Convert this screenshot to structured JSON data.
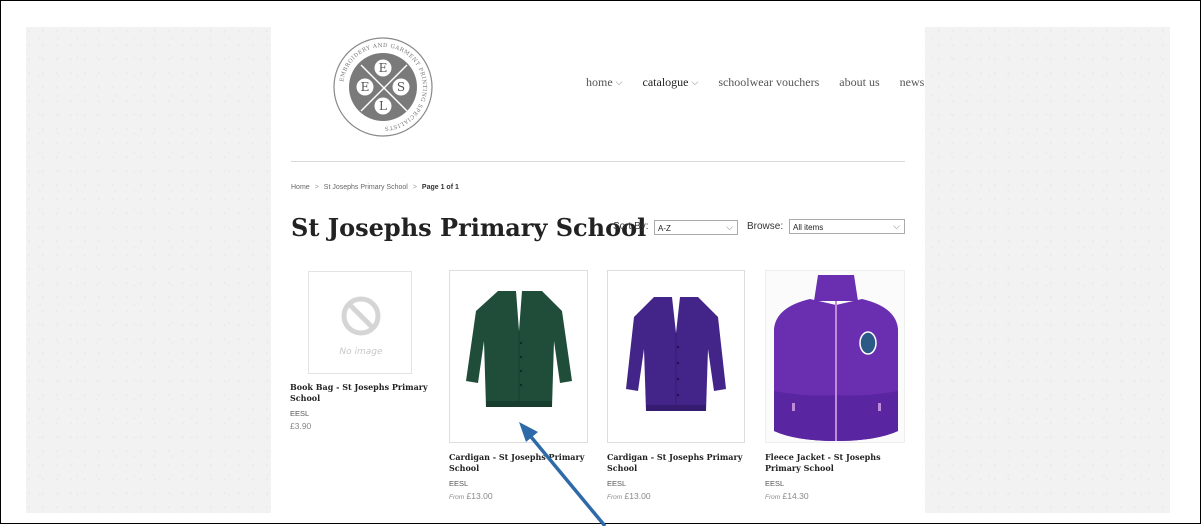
{
  "logo": {
    "ring_text": "EMBROIDERY AND GARMENT PRINTING SPECIALISTS",
    "letters": [
      "E",
      "E",
      "S",
      "L"
    ]
  },
  "nav": {
    "items": [
      {
        "label": "home",
        "has_caret": true
      },
      {
        "label": "catalogue",
        "has_caret": true
      },
      {
        "label": "schoolwear vouchers",
        "has_caret": false
      },
      {
        "label": "about us",
        "has_caret": false
      },
      {
        "label": "news",
        "has_caret": false
      }
    ],
    "caret_glyph": "⌵"
  },
  "breadcrumb": {
    "home": "Home",
    "school": "St Josephs Primary School",
    "page": "Page 1 of 1",
    "separator": ">"
  },
  "page_title": "St Josephs Primary School",
  "sort": {
    "label": "Sort By:",
    "value": "A-Z"
  },
  "browse": {
    "label": "Browse:",
    "value": "All items"
  },
  "products": [
    {
      "name": "Book Bag - St Josephs Primary School",
      "vendor": "EESL",
      "price_prefix": "",
      "price": "£3.90",
      "image": "No image"
    },
    {
      "name": "Cardigan - St Josephs Primary School",
      "vendor": "EESL",
      "price_prefix": "From",
      "price": "£13.00",
      "image": "green cardigan"
    },
    {
      "name": "Cardigan - St Josephs Primary School",
      "vendor": "EESL",
      "price_prefix": "From",
      "price": "£13.00",
      "image": "purple cardigan"
    },
    {
      "name": "Fleece Jacket - St Josephs Primary School",
      "vendor": "EESL",
      "price_prefix": "From",
      "price": "£14.30",
      "image": "purple fleece jacket"
    }
  ],
  "colors": {
    "annotation_arrow": "#2f6aa8",
    "green_cardigan": "#1f4d3a",
    "purple_cardigan": "#43258a",
    "fleece": "#6a2fb0"
  }
}
